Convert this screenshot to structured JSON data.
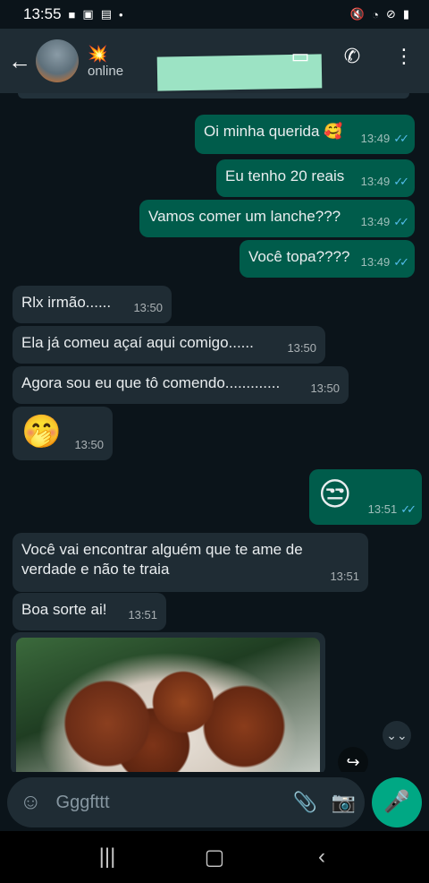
{
  "status_bar": {
    "time": "13:55",
    "left_icons": [
      "video-icon",
      "image-icon",
      "news-icon",
      "dot-icon"
    ],
    "right_icons": [
      "mute-icon",
      "wifi-icon",
      "dnd-icon",
      "battery-icon"
    ]
  },
  "header": {
    "name_emoji": "💥",
    "status": "online"
  },
  "messages": [
    {
      "dir": "out",
      "text": "Oi minha querida 🥰",
      "time": "13:49",
      "read": true
    },
    {
      "dir": "out",
      "text": "Eu tenho 20 reais",
      "time": "13:49",
      "read": true
    },
    {
      "dir": "out",
      "text": "Vamos comer um lanche???",
      "time": "13:49",
      "read": true
    },
    {
      "dir": "out",
      "text": "Você topa????",
      "time": "13:49",
      "read": true
    },
    {
      "dir": "in",
      "text": "Rlx irmão......",
      "time": "13:50"
    },
    {
      "dir": "in",
      "text": "Ela já comeu açaí aqui comigo......",
      "time": "13:50"
    },
    {
      "dir": "in",
      "text": "Agora sou eu que tô comendo.............",
      "time": "13:50"
    },
    {
      "dir": "in",
      "text": "🤭",
      "time": "13:50",
      "emoji_only": true
    },
    {
      "dir": "out",
      "text": "😒",
      "time": "13:51",
      "read": true,
      "emoji_only": true
    },
    {
      "dir": "in",
      "text": "Você vai encontrar alguém que te ame de verdade e não te traia",
      "time": "13:51"
    },
    {
      "dir": "in",
      "text": "Boa sorte ai!",
      "time": "13:51"
    }
  ],
  "ticks": "✓✓",
  "input": {
    "value": "Gggfttt"
  },
  "colors": {
    "background": "#0b141a",
    "outgoing_bubble": "#005c4b",
    "incoming_bubble": "#1f2c34",
    "accent": "#00a884",
    "read_ticks": "#53bdeb"
  }
}
